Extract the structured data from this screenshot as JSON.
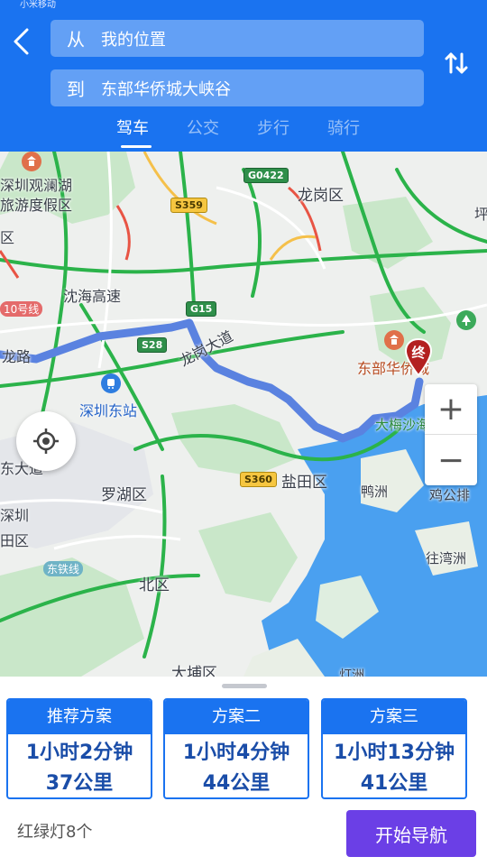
{
  "header": {
    "status_text": "小米移动",
    "from_prefix": "从",
    "from_value": "我的位置",
    "to_prefix": "到",
    "to_value": "东部华侨城大峡谷",
    "modes": [
      "驾车",
      "公交",
      "步行",
      "骑行"
    ],
    "active_mode": "驾车"
  },
  "map": {
    "labels": [
      "深圳观澜湖",
      "旅游度假区",
      "龙岗区",
      "沈海高速",
      "龙岗大道",
      "深圳东站",
      "东部华侨城",
      "大梅沙海滨公园",
      "盐田区",
      "罗湖区",
      "鸭洲",
      "鸡公排",
      "深圳",
      "田区",
      "北区",
      "往湾洲",
      "大埔区",
      "灯洲",
      "区",
      "龙路",
      "东大道",
      "坪"
    ],
    "road_badges": [
      "G0422",
      "S359",
      "G15",
      "S28",
      "S360"
    ],
    "metro_badges": [
      "10号线",
      "东铁线"
    ],
    "end_marker": "终",
    "zoom_in": "+",
    "zoom_out": "−"
  },
  "plans": [
    {
      "title": "推荐方案",
      "time": "1小时2分钟",
      "distance": "37公里"
    },
    {
      "title": "方案二",
      "time": "1小时4分钟",
      "distance": "44公里"
    },
    {
      "title": "方案三",
      "time": "1小时13分钟",
      "distance": "41公里"
    }
  ],
  "footer": {
    "traffic_lights": "红绿灯8个",
    "start_nav": "开始导航"
  },
  "colors": {
    "header": "#1a73f0",
    "route": "#5a82e0",
    "nav_button": "#6b3fe6",
    "water": "#4aa0f0"
  }
}
